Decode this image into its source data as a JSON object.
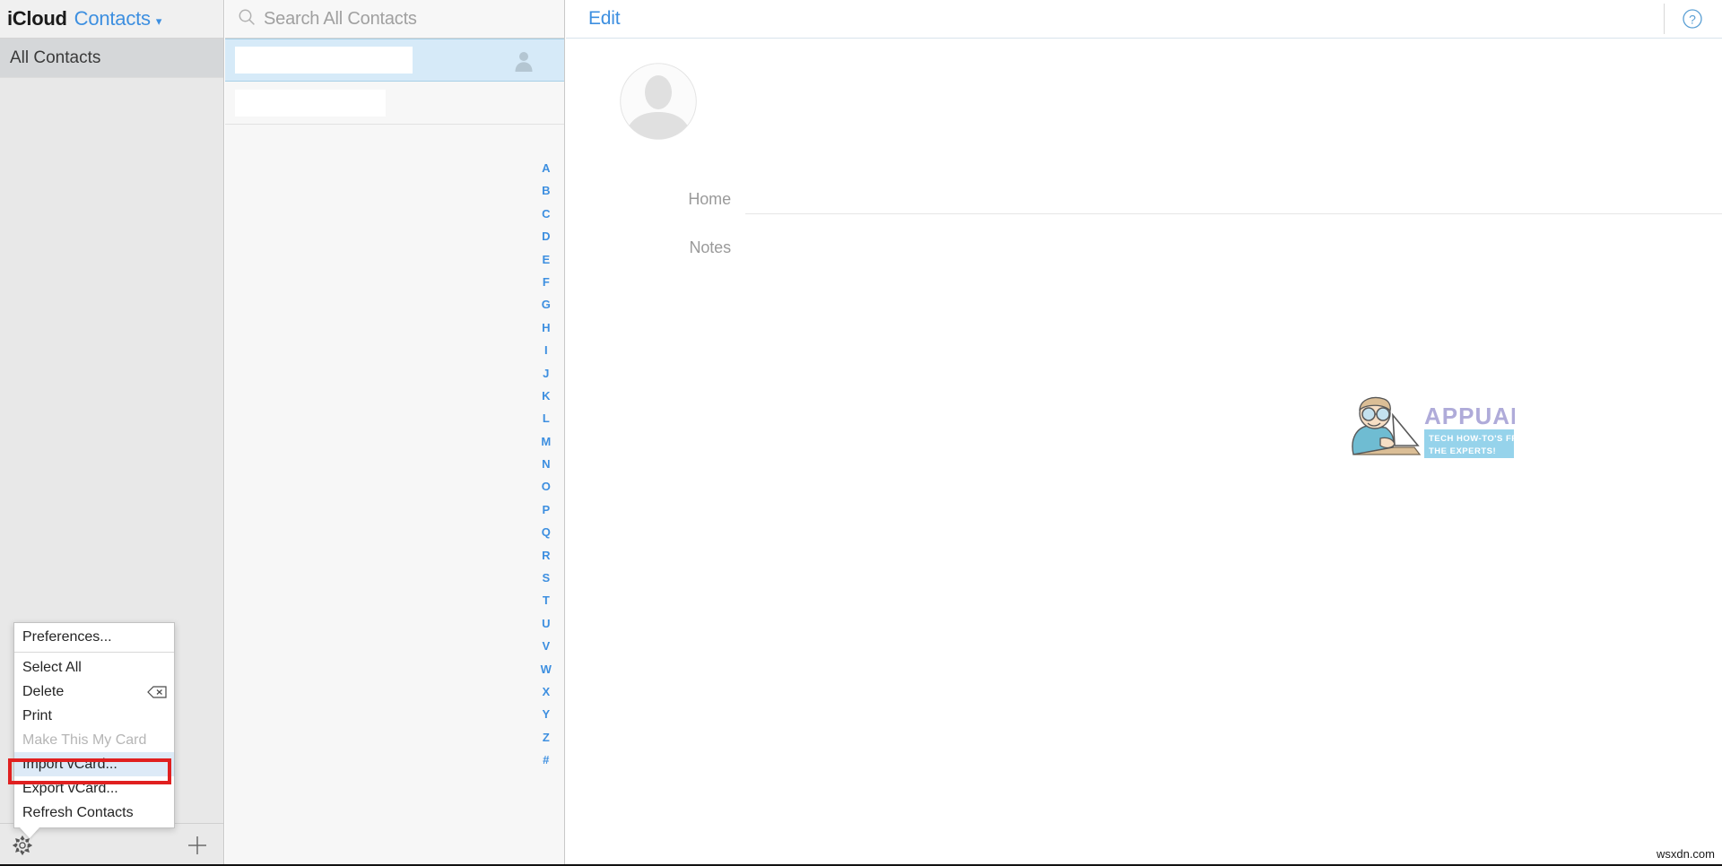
{
  "window": {
    "bottom_watermark": "wsxdn.com"
  },
  "sidebar": {
    "brand": {
      "icloud": "iCloud",
      "app": "Contacts",
      "chevron": "chevron-down"
    },
    "items": [
      {
        "label": "All Contacts",
        "selected": true
      }
    ],
    "footer": {
      "settings_icon": "gear-icon",
      "add_icon": "plus-icon"
    }
  },
  "context_menu": {
    "visible": true,
    "highlighted": "Import vCard...",
    "highlight_color": "#ddeaf7",
    "annotation_color": "#e02020",
    "items": [
      {
        "label": "Preferences...",
        "disabled": false,
        "separator_after": true,
        "shortcut": ""
      },
      {
        "label": "Select All",
        "disabled": false,
        "shortcut": ""
      },
      {
        "label": "Delete",
        "disabled": false,
        "shortcut": "delete-key-icon"
      },
      {
        "label": "Print",
        "disabled": false,
        "shortcut": ""
      },
      {
        "label": "Make This My Card",
        "disabled": true,
        "shortcut": ""
      },
      {
        "label": "Import vCard...",
        "disabled": false,
        "shortcut": "",
        "highlighted": true
      },
      {
        "label": "Export vCard...",
        "disabled": false,
        "shortcut": ""
      },
      {
        "label": "Refresh Contacts",
        "disabled": false,
        "shortcut": ""
      }
    ]
  },
  "contact_list": {
    "search": {
      "placeholder": "Search All Contacts",
      "value": "",
      "icon": "search-icon"
    },
    "rows": [
      {
        "name": "",
        "redacted": true,
        "selected": true,
        "avatar_icon": "person-icon"
      },
      {
        "name": "",
        "redacted": true,
        "selected": false,
        "avatar_icon": ""
      }
    ],
    "alpha_index": [
      "A",
      "B",
      "C",
      "D",
      "E",
      "F",
      "G",
      "H",
      "I",
      "J",
      "K",
      "L",
      "M",
      "N",
      "O",
      "P",
      "Q",
      "R",
      "S",
      "T",
      "U",
      "V",
      "W",
      "X",
      "Y",
      "Z",
      "#"
    ],
    "alpha_index_color": "#3d8fe0"
  },
  "detail": {
    "edit_label": "Edit",
    "help_icon": "question-mark-circle-icon",
    "avatar_icon": "person-placeholder-icon",
    "fields": [
      {
        "label": "Home",
        "value": ""
      },
      {
        "label": "Notes",
        "value": ""
      }
    ]
  },
  "watermark": {
    "brand": "APPUALS",
    "tagline_line1": "TECH HOW-TO'S FROM",
    "tagline_line2": "THE EXPERTS!",
    "brand_color": "#a9a4d6",
    "banner_color": "#8ed0ea"
  }
}
